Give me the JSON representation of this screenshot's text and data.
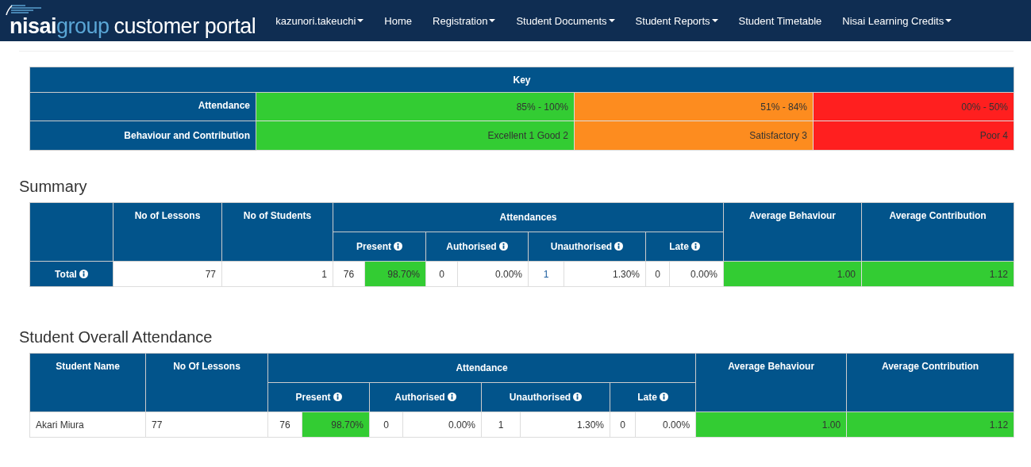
{
  "nav": {
    "logo": {
      "brand": "nisai",
      "group": "group",
      "portal": "customer portal"
    },
    "items": [
      {
        "label": "kazunori.takeuchi",
        "dropdown": true
      },
      {
        "label": "Home",
        "dropdown": false
      },
      {
        "label": "Registration",
        "dropdown": true
      },
      {
        "label": "Student Documents",
        "dropdown": true
      },
      {
        "label": "Student Reports",
        "dropdown": true
      },
      {
        "label": "Student Timetable",
        "dropdown": false
      },
      {
        "label": "Nisai Learning Credits",
        "dropdown": true
      }
    ]
  },
  "key": {
    "title": "Key",
    "rows": [
      {
        "label": "Attendance",
        "cells": [
          {
            "text": "85% - 100%",
            "color": "#33cc33"
          },
          {
            "text": "51% - 84%",
            "color": "#fd8c1f"
          },
          {
            "text": "00% - 50%",
            "color": "#ff1f1f"
          }
        ]
      },
      {
        "label": "Behaviour and Contribution",
        "cells": [
          {
            "text": "Excellent 1 Good 2",
            "color": "#33cc33"
          },
          {
            "text": "Satisfactory 3",
            "color": "#fd8c1f"
          },
          {
            "text": "Poor 4",
            "color": "#ff1f1f"
          }
        ]
      }
    ]
  },
  "summary": {
    "heading": "Summary",
    "columns": [
      "No of Lessons",
      "No of Students"
    ],
    "group": {
      "label": "Attendances",
      "subcolumns": [
        {
          "label": "Present",
          "info": true
        },
        {
          "label": "Authorised",
          "info": true
        },
        {
          "label": "Unauthorised",
          "info": true
        },
        {
          "label": "Late",
          "info": true
        }
      ]
    },
    "trailing_columns": [
      "Average Behaviour",
      "Average Contribution"
    ],
    "rows": [
      {
        "label": "Total",
        "info": true,
        "cells": [
          {
            "text": "77",
            "kind": "number"
          },
          {
            "text": "1",
            "kind": "number"
          },
          {
            "text": "76",
            "kind": "count"
          },
          {
            "text": "98.70%",
            "kind": "number",
            "color": "#33cc33"
          },
          {
            "text": "0",
            "kind": "count"
          },
          {
            "text": "0.00%",
            "kind": "number"
          },
          {
            "text": "1",
            "kind": "count",
            "link": true
          },
          {
            "text": "1.30%",
            "kind": "number"
          },
          {
            "text": "0",
            "kind": "count"
          },
          {
            "text": "0.00%",
            "kind": "number"
          },
          {
            "text": "1.00",
            "kind": "number",
            "color": "#33cc33"
          },
          {
            "text": "1.12",
            "kind": "number",
            "color": "#33cc33"
          }
        ]
      }
    ]
  },
  "students": {
    "heading": "Student Overall Attendance",
    "columns": [
      "Student Name",
      "No Of Lessons"
    ],
    "group": {
      "label": "Attendance",
      "subcolumns": [
        {
          "label": "Present",
          "info": true
        },
        {
          "label": "Authorised",
          "info": true
        },
        {
          "label": "Unauthorised",
          "info": true
        },
        {
          "label": "Late",
          "info": true
        }
      ]
    },
    "trailing_columns": [
      "Average Behaviour",
      "Average Contribution"
    ],
    "rows": [
      {
        "cells": [
          {
            "text": "Akari Miura",
            "kind": "text"
          },
          {
            "text": "77",
            "kind": "text"
          },
          {
            "text": "76",
            "kind": "count"
          },
          {
            "text": "98.70%",
            "kind": "number",
            "color": "#33cc33"
          },
          {
            "text": "0",
            "kind": "count"
          },
          {
            "text": "0.00%",
            "kind": "number"
          },
          {
            "text": "1",
            "kind": "count"
          },
          {
            "text": "1.30%",
            "kind": "number"
          },
          {
            "text": "0",
            "kind": "count"
          },
          {
            "text": "0.00%",
            "kind": "number"
          },
          {
            "text": "1.00",
            "kind": "number",
            "color": "#33cc33"
          },
          {
            "text": "1.12",
            "kind": "number",
            "color": "#33cc33"
          }
        ]
      }
    ]
  }
}
